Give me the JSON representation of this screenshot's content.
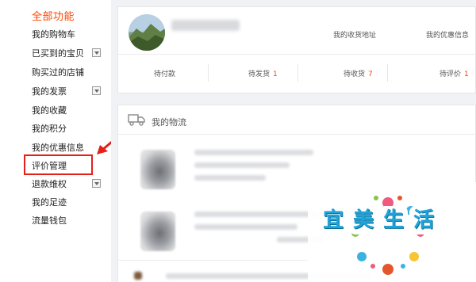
{
  "sidebar": {
    "title": "全部功能",
    "items": [
      {
        "label": "我的购物车",
        "expandable": false
      },
      {
        "label": "已买到的宝贝",
        "expandable": true
      },
      {
        "label": "购买过的店铺",
        "expandable": false
      },
      {
        "label": "我的发票",
        "expandable": true
      },
      {
        "label": "我的收藏",
        "expandable": false
      },
      {
        "label": "我的积分",
        "expandable": false
      },
      {
        "label": "我的优惠信息",
        "expandable": false
      },
      {
        "label": "评价管理",
        "expandable": false
      },
      {
        "label": "退款维权",
        "expandable": true
      },
      {
        "label": "我的足迹",
        "expandable": false
      },
      {
        "label": "流量钱包",
        "expandable": false
      }
    ]
  },
  "profile": {
    "address_link": "我的收货地址",
    "coupon_link": "我的优惠信息"
  },
  "order_status": {
    "pending_payment": {
      "label": "待付款",
      "count": ""
    },
    "pending_shipment": {
      "label": "待发货",
      "count": "1"
    },
    "pending_receipt": {
      "label": "待收货",
      "count": "7"
    },
    "pending_review": {
      "label": "待评价",
      "count": "1"
    }
  },
  "logistics": {
    "title": "我的物流"
  },
  "watermark": {
    "text": [
      "宜",
      "美",
      "生",
      "活"
    ]
  },
  "colors": {
    "accent": "#ff4400",
    "highlight_box": "#e32119",
    "watermark_text": "#1fa3d8"
  }
}
